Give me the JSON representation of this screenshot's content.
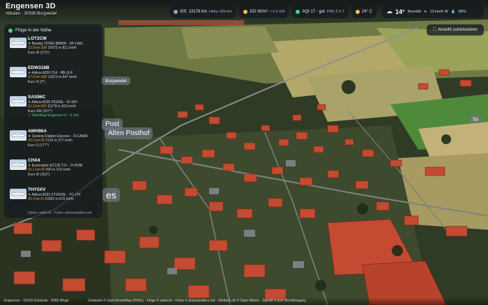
{
  "app": {
    "title": "Engensen 3D",
    "subtitle": "Altkalen · 30938 Burgwedel"
  },
  "status": {
    "iss": {
      "label": "ISS",
      "value": "13176 km",
      "sub": "Höhe 439 km"
    },
    "solar": {
      "value": "152 W/m²",
      "sub": "≈ 0.6 kW"
    },
    "aqi": {
      "value": "AQI 17 · gut",
      "sub": "PM2.5 6.7"
    },
    "temp_small": {
      "value": "24° C"
    }
  },
  "weather": {
    "temp": "14°",
    "condition": "Bewölkt",
    "wind": "13 km/h W",
    "humidity": "88%"
  },
  "reset_view": "Ansicht zurücksetzen",
  "flights_panel": {
    "title": "Flüge in der Nähe",
    "flights": [
      {
        "callsign": "LOT2CM",
        "aircraft": "Boeing 737NG 88N/W · SP-LWG",
        "speed": "12.9 km SW",
        "alt": "10973 m",
        "kmh": "811 km/h",
        "course": "Kurs W (273°)"
      },
      {
        "callsign": "EDW318B",
        "aircraft": "Airbus A320 214 · HB-JLR",
        "speed": "17.0 km NW",
        "alt": "10973 m",
        "kmh": "847 km/h",
        "course": "Kurs N (2°)"
      },
      {
        "callsign": "SAS96C",
        "aircraft": "Airbus A320 251NSL · EI-SIH",
        "speed": "21.3 km NO",
        "alt": "11278 m",
        "kmh": "823 km/h",
        "course": "Kurs SW (207°)",
        "overflight": "Überfliegt Engensen in ~2 min"
      },
      {
        "callsign": "AWH96A",
        "aircraft": "Cessna Citation Encore+ · D-CAWR",
        "speed": "25.2 km W",
        "alt": "2126 m",
        "kmh": "377 km/h",
        "course": "Kurs S (177°)"
      },
      {
        "callsign": "CHX4",
        "aircraft": "Eurocopter EC135 T2+ · D-HVBI",
        "speed": "21.1 km W",
        "alt": "290 m",
        "kmh": "216 km/h",
        "course": "Kurs W (263°)"
      },
      {
        "callsign": "THY5XV",
        "aircraft": "Airbus A321 271NXSL · TC-LTF",
        "speed": "25.3 km N",
        "alt": "10363 m",
        "kmh": "815 km/h",
        "course": ""
      }
    ],
    "footer": "Daten: adsb.lol · Fotos: planespotters.net"
  },
  "map_labels": {
    "post": "Post",
    "burgwedel": "Burgwedel",
    "posthof": "Alten Posthof",
    "les": "es",
    "sp": "Sp"
  },
  "bottom": {
    "stats": "Engensen · 18109 Gebäude · 5582 Wege",
    "credits": "Gebäude © OpenStreetMap (ODbL) · Flüge © adsb.lol · Fotos © planespotters.net · Wetter/Luft © Open-Meteo · Satellit © Esri WorldImagery"
  },
  "colors": {
    "accent_green": "#47d67a",
    "accent_orange": "#f2a43a",
    "roof_red": "#c9462f",
    "panel": "#161a20"
  }
}
